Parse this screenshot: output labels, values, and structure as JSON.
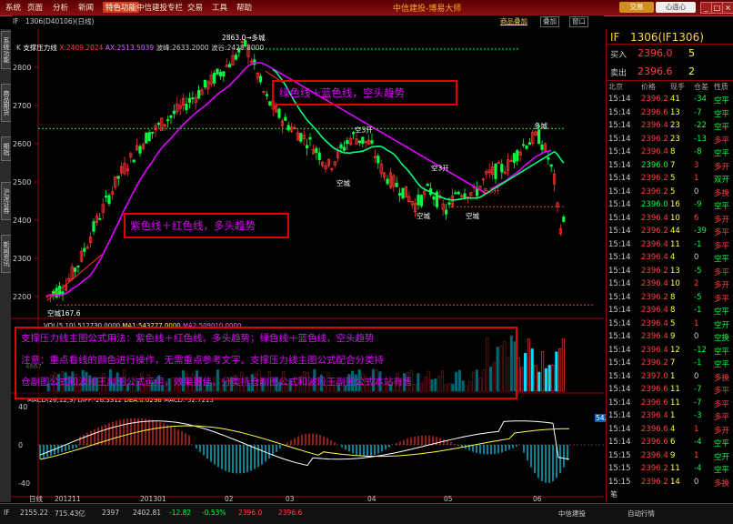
{
  "menubar": {
    "items": [
      {
        "label": "系统",
        "x": 6
      },
      {
        "label": "页面",
        "x": 30
      },
      {
        "label": "分析",
        "x": 58
      },
      {
        "label": "新闻",
        "x": 86
      },
      {
        "label": "特色功能",
        "x": 113,
        "active": true
      },
      {
        "label": "中信建投专栏",
        "x": 150
      },
      {
        "label": "交易",
        "x": 206
      },
      {
        "label": "工具",
        "x": 233
      },
      {
        "label": "帮助",
        "x": 260
      }
    ],
    "brand": "中信建投-博易大师",
    "trade_button": "交易",
    "check_button": "心连心"
  },
  "sidebar": {
    "tabs": [
      {
        "label": "系统功能",
        "y": 2,
        "h": 40
      },
      {
        "label": "商品期货",
        "y": 60,
        "h": 40
      },
      {
        "label": "期指",
        "y": 118,
        "h": 25
      },
      {
        "label": "沪深证券",
        "y": 168,
        "h": 40
      },
      {
        "label": "新闻资讯",
        "y": 226,
        "h": 40
      }
    ]
  },
  "chart_header": {
    "symbol": "IF",
    "contract": "1306(D40106)(日线)",
    "products_label": "商品叠加",
    "tab1": "叠加",
    "tab2": "窗口"
  },
  "main_indicator": {
    "prefix": "K",
    "name": "支撑压力线",
    "x_label": "X:2409.2024",
    "ax_label": "AX:2513.5039",
    "wave_label": "波峰:2633.2000",
    "trough_label": "波谷:2428.8000"
  },
  "volume_indicator": {
    "label": "VOL(5,10)",
    "vol": "512730.0000",
    "ma1": "MA1:543277.0000",
    "ma2": "MA2:509010.0000",
    "tick": "4667"
  },
  "macd_indicator": {
    "label": "MACD(26,12,9)",
    "diff": "DIFF:-26.3312",
    "dea": "DEA:0.0296",
    "macd": "MACD:-52.7215",
    "right_value": "54.9"
  },
  "chart_labels": {
    "peak_top": "2863.0→多城",
    "bottom_low": "空城167.6",
    "kongcheng": "空城",
    "kongping": "空3开",
    "duocheng": "多城",
    "duoping": "多3开"
  },
  "annotations": {
    "bear": "绿色线＋蓝色线，空头趋势",
    "bull": "紫色线＋红色线，多头趋势",
    "note_lines": [
      "支撑压力线主图公式用法：紫色线＋红色线，多头趋势；绿色线＋蓝色线，空头趋势",
      "注意：重点看线的颜色进行操作，无需重点参考文字。支撑压力线主图公式配合分类持",
      "仓副图公式和波段王副图公式运用，效果更佳，分类持仓副图公式和波段王副图公式本站有售"
    ]
  },
  "y_ticks": [
    "2800",
    "2700",
    "2600",
    "2500",
    "2400",
    "2300",
    "2200"
  ],
  "macd_ticks": [
    "40",
    "0",
    "-40"
  ],
  "x_ticks": [
    {
      "label": "日线",
      "x": 20
    },
    {
      "label": "201211",
      "x": 48
    },
    {
      "label": "201301",
      "x": 142
    },
    {
      "label": "02",
      "x": 235
    },
    {
      "label": "03",
      "x": 302
    },
    {
      "label": "04",
      "x": 392
    },
    {
      "label": "05",
      "x": 476
    },
    {
      "label": "06",
      "x": 574
    }
  ],
  "quote_panel": {
    "symbol": "IF",
    "contract": "1306(IF1306)",
    "buy_label": "买入",
    "buy_price": "2396.0",
    "buy_qty": "5",
    "sell_label": "卖出",
    "sell_price": "2396.6",
    "sell_qty": "2",
    "headers": [
      "北京",
      "价格",
      "现手",
      "仓差",
      "性质"
    ],
    "rows": [
      {
        "time": "15:14",
        "price": "2396.2",
        "vol": "41",
        "oi": "-34",
        "nature": "空平"
      },
      {
        "time": "15:14",
        "price": "2396.6",
        "vol": "13",
        "oi": "-7",
        "nature": "空平"
      },
      {
        "time": "15:14",
        "price": "2396.4",
        "vol": "23",
        "oi": "-22",
        "nature": "空平"
      },
      {
        "time": "15:14",
        "price": "2396.2",
        "vol": "23",
        "oi": "-13",
        "nature": "多平"
      },
      {
        "time": "15:14",
        "price": "2396.4",
        "vol": "8",
        "oi": "-8",
        "nature": "空平"
      },
      {
        "time": "15:14",
        "price": "2396.0",
        "vol": "7",
        "oi": "3",
        "nature": "多开"
      },
      {
        "time": "15:14",
        "price": "2396.2",
        "vol": "5",
        "oi": "1",
        "nature": "双开"
      },
      {
        "time": "15:14",
        "price": "2396.2",
        "vol": "5",
        "oi": "0",
        "nature": "多换"
      },
      {
        "time": "15:14",
        "price": "2396.0",
        "vol": "16",
        "oi": "-9",
        "nature": "空平"
      },
      {
        "time": "15:14",
        "price": "2396.4",
        "vol": "10",
        "oi": "6",
        "nature": "多开"
      },
      {
        "time": "15:14",
        "price": "2396.2",
        "vol": "44",
        "oi": "-39",
        "nature": "多平"
      },
      {
        "time": "15:14",
        "price": "2396.4",
        "vol": "11",
        "oi": "-1",
        "nature": "多平"
      },
      {
        "time": "15:14",
        "price": "2396.4",
        "vol": "4",
        "oi": "0",
        "nature": "空平"
      },
      {
        "time": "15:14",
        "price": "2396.2",
        "vol": "13",
        "oi": "-5",
        "nature": "多平"
      },
      {
        "time": "15:14",
        "price": "2396.4",
        "vol": "10",
        "oi": "2",
        "nature": "多开"
      },
      {
        "time": "15:14",
        "price": "2396.2",
        "vol": "8",
        "oi": "-5",
        "nature": "多平"
      },
      {
        "time": "15:14",
        "price": "2396.4",
        "vol": "8",
        "oi": "-1",
        "nature": "空平"
      },
      {
        "time": "15:14",
        "price": "2396.4",
        "vol": "5",
        "oi": "1",
        "nature": "空开"
      },
      {
        "time": "15:14",
        "price": "2396.4",
        "vol": "9",
        "oi": "0",
        "nature": "空换"
      },
      {
        "time": "15:14",
        "price": "2396.4",
        "vol": "12",
        "oi": "-12",
        "nature": "空平"
      },
      {
        "time": "15:14",
        "price": "2396.2",
        "vol": "7",
        "oi": "-1",
        "nature": "空平"
      },
      {
        "time": "15:14",
        "price": "2397.0",
        "vol": "1",
        "oi": "0",
        "nature": "多换"
      },
      {
        "time": "15:14",
        "price": "2396.6",
        "vol": "11",
        "oi": "-7",
        "nature": "多平"
      },
      {
        "time": "15:14",
        "price": "2396.6",
        "vol": "11",
        "oi": "-7",
        "nature": "多平"
      },
      {
        "time": "15:14",
        "price": "2396.4",
        "vol": "1",
        "oi": "-3",
        "nature": "多平"
      },
      {
        "time": "15:14",
        "price": "2396.6",
        "vol": "4",
        "oi": "1",
        "nature": "多开"
      },
      {
        "time": "15:14",
        "price": "2396.6",
        "vol": "6",
        "oi": "-4",
        "nature": "空平"
      },
      {
        "time": "15:15",
        "price": "2396.4",
        "vol": "9",
        "oi": "1",
        "nature": "空开"
      },
      {
        "time": "15:15",
        "price": "2396.2",
        "vol": "11",
        "oi": "-4",
        "nature": "空平"
      },
      {
        "time": "15:15",
        "price": "2396.2",
        "vol": "14",
        "oi": "0",
        "nature": "多换"
      }
    ],
    "footer": "笔"
  },
  "statusbar": {
    "items": [
      "IF",
      "2155.22",
      "715.43亿",
      "2397",
      "2402.81",
      "-12.82",
      "-0.53%",
      "2396.0",
      "2396.6",
      "中信建投",
      "自动行情"
    ]
  },
  "colors": {
    "up": "#ff3030",
    "down": "#00ff40",
    "ma_magenta": "#e000ff",
    "ma_green": "#00ff80",
    "annotation": "#e000ff"
  }
}
